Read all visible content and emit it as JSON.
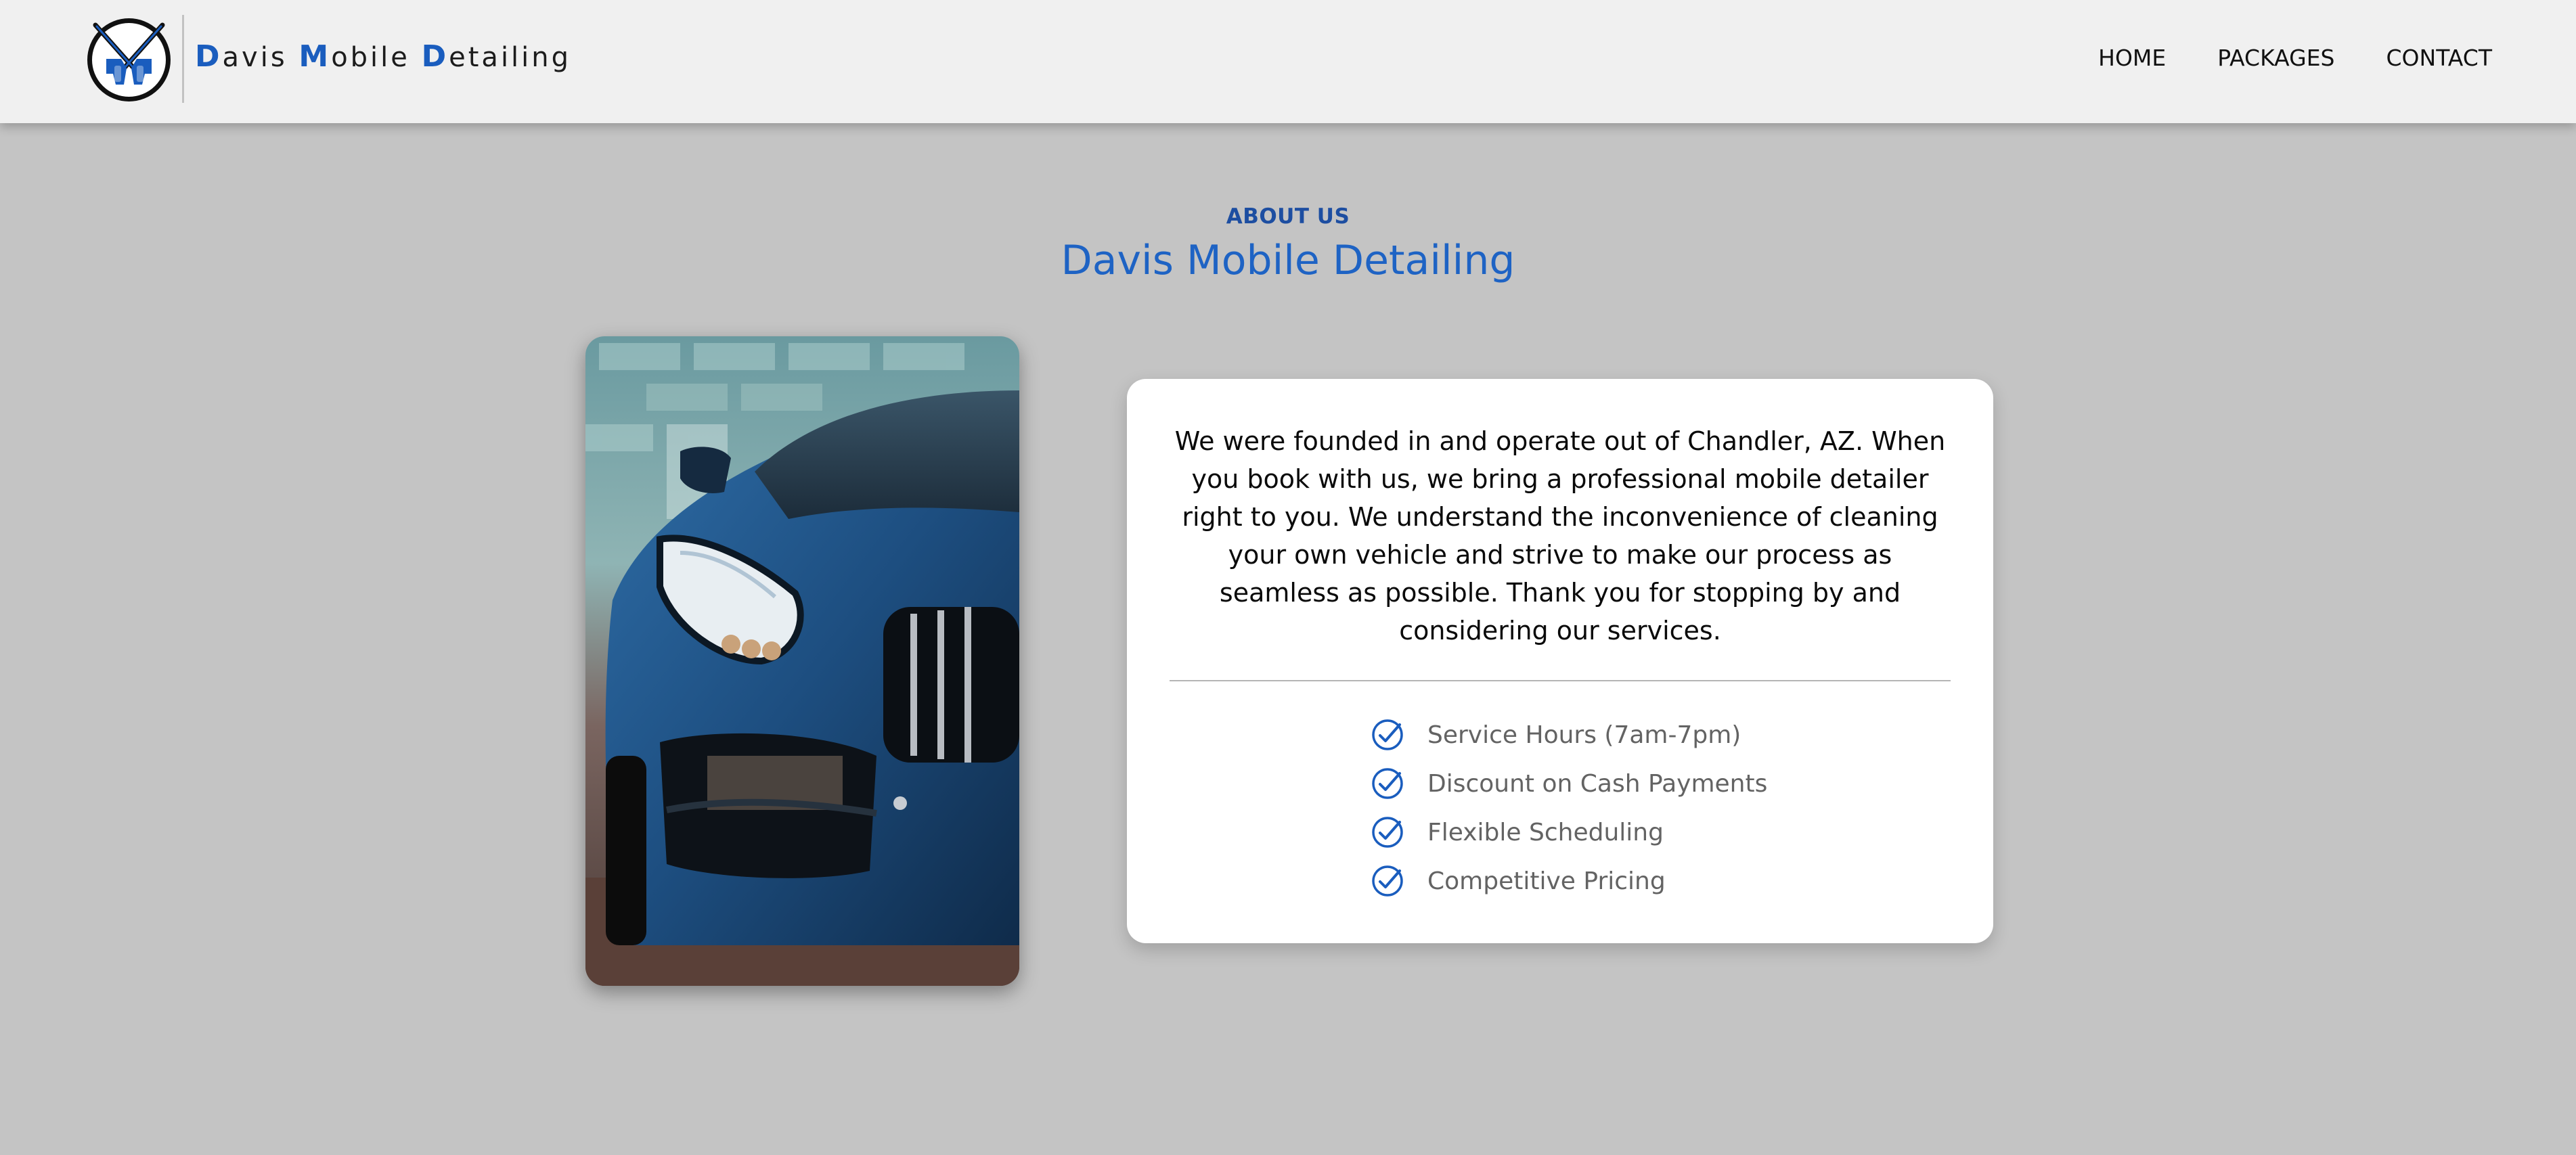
{
  "brand": {
    "name_parts": [
      {
        "cap": "D",
        "rest": "avis "
      },
      {
        "cap": "M",
        "rest": "obile "
      },
      {
        "cap": "D",
        "rest": "etailing"
      }
    ],
    "accent_color": "#1a5dbe",
    "logo_icon": "crossed-pressure-washers-icon"
  },
  "nav": {
    "items": [
      "HOME",
      "PACKAGES",
      "CONTACT"
    ]
  },
  "about": {
    "eyebrow": "ABOUT US",
    "title": "Davis Mobile Detailing",
    "photo_icon": "blue-sports-car-photo",
    "description": "We were founded in and operate out of Chandler, AZ. When you book with us, we bring a professional mobile detailer right to you. We understand the inconvenience of cleaning your own vehicle and strive to make our process as seamless as possible. Thank you for stopping by and considering our services.",
    "features": [
      {
        "label": "Service Hours (7am-7pm)",
        "icon": "check-circle-icon"
      },
      {
        "label": "Discount on Cash Payments",
        "icon": "check-circle-icon"
      },
      {
        "label": "Flexible Scheduling",
        "icon": "check-circle-icon"
      },
      {
        "label": "Competitive Pricing",
        "icon": "check-circle-icon"
      }
    ]
  },
  "colors": {
    "background": "#c4c4c4",
    "header": "#f0f0f0",
    "title_blue": "#1e63c4",
    "eyebrow_blue": "#1d4ea1"
  }
}
